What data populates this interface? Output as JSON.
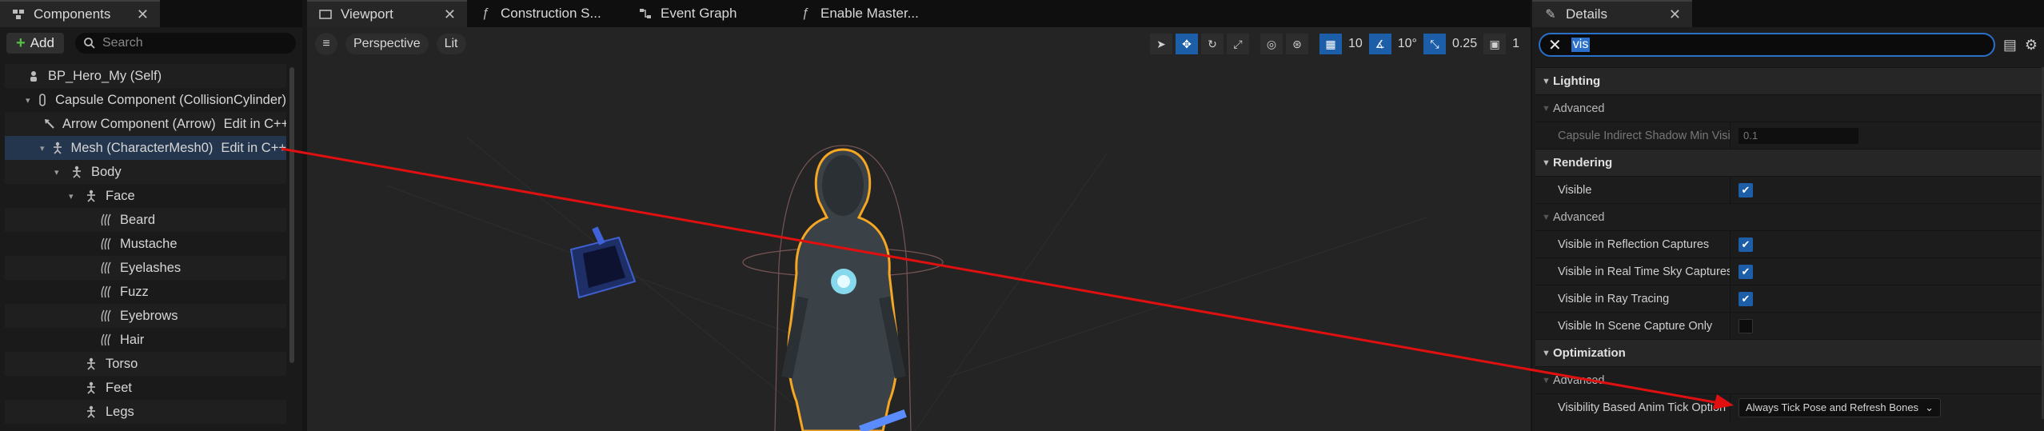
{
  "components": {
    "tab_label": "Components",
    "close": "✕",
    "add_label": "Add",
    "search_placeholder": "Search",
    "tree": [
      {
        "label": "BP_Hero_My (Self)",
        "indent": 0,
        "arrow": "",
        "icon": "person-icon"
      },
      {
        "label": "Capsule Component (CollisionCylinder)",
        "indent": 1,
        "arrow": "▾",
        "icon": "capsule-icon"
      },
      {
        "label": "Arrow Component (Arrow)",
        "indent": 2,
        "arrow": "",
        "icon": "arrow-icon",
        "edit": "Edit in C++"
      },
      {
        "label": "Mesh (CharacterMesh0)",
        "indent": 2,
        "arrow": "▾",
        "icon": "skeleton-icon",
        "edit": "Edit in C++",
        "selected": true
      },
      {
        "label": "Body",
        "indent": 3,
        "arrow": "▾",
        "icon": "skeleton-icon"
      },
      {
        "label": "Face",
        "indent": 4,
        "arrow": "▾",
        "icon": "skeleton-icon"
      },
      {
        "label": "Beard",
        "indent": 5,
        "arrow": "",
        "icon": "groom-icon"
      },
      {
        "label": "Mustache",
        "indent": 5,
        "arrow": "",
        "icon": "groom-icon"
      },
      {
        "label": "Eyelashes",
        "indent": 5,
        "arrow": "",
        "icon": "groom-icon"
      },
      {
        "label": "Fuzz",
        "indent": 5,
        "arrow": "",
        "icon": "groom-icon"
      },
      {
        "label": "Eyebrows",
        "indent": 5,
        "arrow": "",
        "icon": "groom-icon"
      },
      {
        "label": "Hair",
        "indent": 5,
        "arrow": "",
        "icon": "groom-icon"
      },
      {
        "label": "Torso",
        "indent": 4,
        "arrow": "",
        "icon": "skeleton-icon"
      },
      {
        "label": "Feet",
        "indent": 4,
        "arrow": "",
        "icon": "skeleton-icon"
      },
      {
        "label": "Legs",
        "indent": 4,
        "arrow": "",
        "icon": "skeleton-icon"
      }
    ]
  },
  "viewport": {
    "tabs": [
      {
        "label": "Viewport",
        "close": "✕",
        "icon": "viewport-icon"
      },
      {
        "label": "Construction S...",
        "icon": "function-icon"
      },
      {
        "label": "Event Graph",
        "icon": "graph-icon"
      },
      {
        "label": "Enable Master...",
        "icon": "function-icon"
      }
    ],
    "perspective_label": "Perspective",
    "lit_label": "Lit",
    "grid_snap": "10",
    "rotation_snap": "10°",
    "scale_snap": "0.25",
    "camera_speed": "1"
  },
  "details": {
    "tab_label": "Details",
    "close": "✕",
    "search_value": "vis",
    "categories": [
      {
        "name": "Lighting",
        "rows": [
          {
            "type": "sub",
            "label": "Advanced"
          },
          {
            "type": "num",
            "label": "Capsule Indirect Shadow Min Visibility",
            "value": "0.1",
            "dim": true
          }
        ]
      },
      {
        "name": "Rendering",
        "rows": [
          {
            "type": "check",
            "label": "Visible",
            "checked": true
          },
          {
            "type": "sub",
            "label": "Advanced"
          },
          {
            "type": "check",
            "label": "Visible in Reflection Captures",
            "checked": true
          },
          {
            "type": "check",
            "label": "Visible in Real Time Sky Captures",
            "checked": true
          },
          {
            "type": "check",
            "label": "Visible in Ray Tracing",
            "checked": true
          },
          {
            "type": "check",
            "label": "Visible In Scene Capture Only",
            "checked": false
          }
        ]
      },
      {
        "name": "Optimization",
        "rows": [
          {
            "type": "sub",
            "label": "Advanced"
          },
          {
            "type": "dropdown",
            "label": "Visibility Based Anim Tick Option",
            "value": "Always Tick Pose and Refresh Bones"
          }
        ]
      }
    ]
  },
  "colors": {
    "accent": "#1d5ea9",
    "annotation_arrow": "#e01010",
    "selection_outline": "#f5a623"
  }
}
